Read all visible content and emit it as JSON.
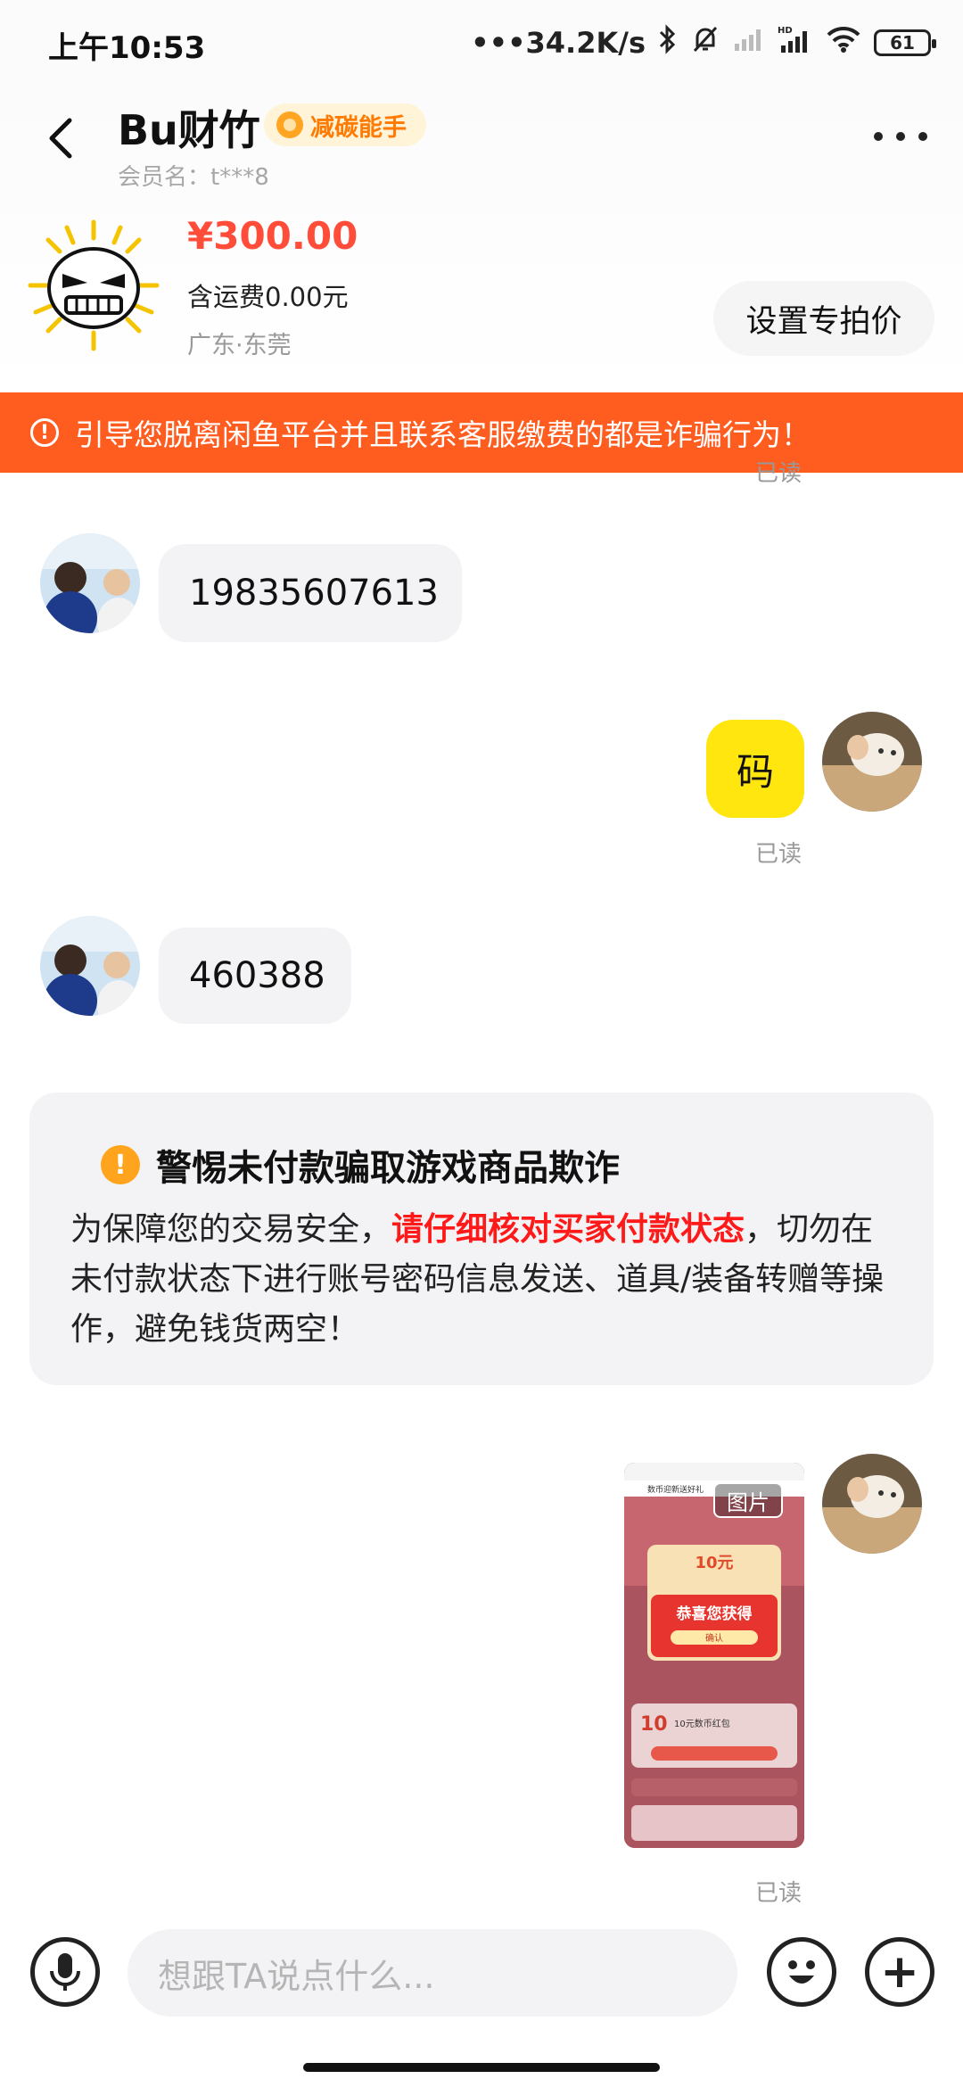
{
  "status_bar": {
    "time": "上午10:53",
    "speed": "•••34.2K/s",
    "battery": "61"
  },
  "header": {
    "seller_name": "Bu财竹",
    "badge": "减碳能手",
    "member": "会员名：t***8"
  },
  "product": {
    "price": "¥300.00",
    "shipping": "含运费0.00元",
    "location": "广东·东莞",
    "set_price_button": "设置专拍价"
  },
  "warning_banner": "引导您脱离闲鱼平台并且联系客服缴费的都是诈骗行为！",
  "messages": [
    {
      "text": "19835607613"
    },
    {
      "text": "码",
      "read": "已读"
    },
    {
      "text": "460388"
    }
  ],
  "read_top": "已读",
  "notice": {
    "title": "警惕未付款骗取游戏商品欺诈",
    "body_pre": "为保障您的交易安全，",
    "body_red": "请仔细核对买家付款状态",
    "body_post": "，切勿在未付款状态下进行账号密码信息发送、道具/装备转赠等操作，避免钱货两空！"
  },
  "image_message": {
    "label": "图片",
    "read": "已读",
    "thumb": {
      "page_title": "数币迎新送好礼",
      "amount": "10元",
      "congrats": "恭喜您获得",
      "confirm": "确认",
      "coupon": "10元数币红包"
    }
  },
  "composer": {
    "placeholder": "想跟TA说点什么..."
  },
  "colors": {
    "accent_yellow": "#ffe60f",
    "banner_orange": "#ff5c1f",
    "price_red": "#ff4d3a"
  }
}
